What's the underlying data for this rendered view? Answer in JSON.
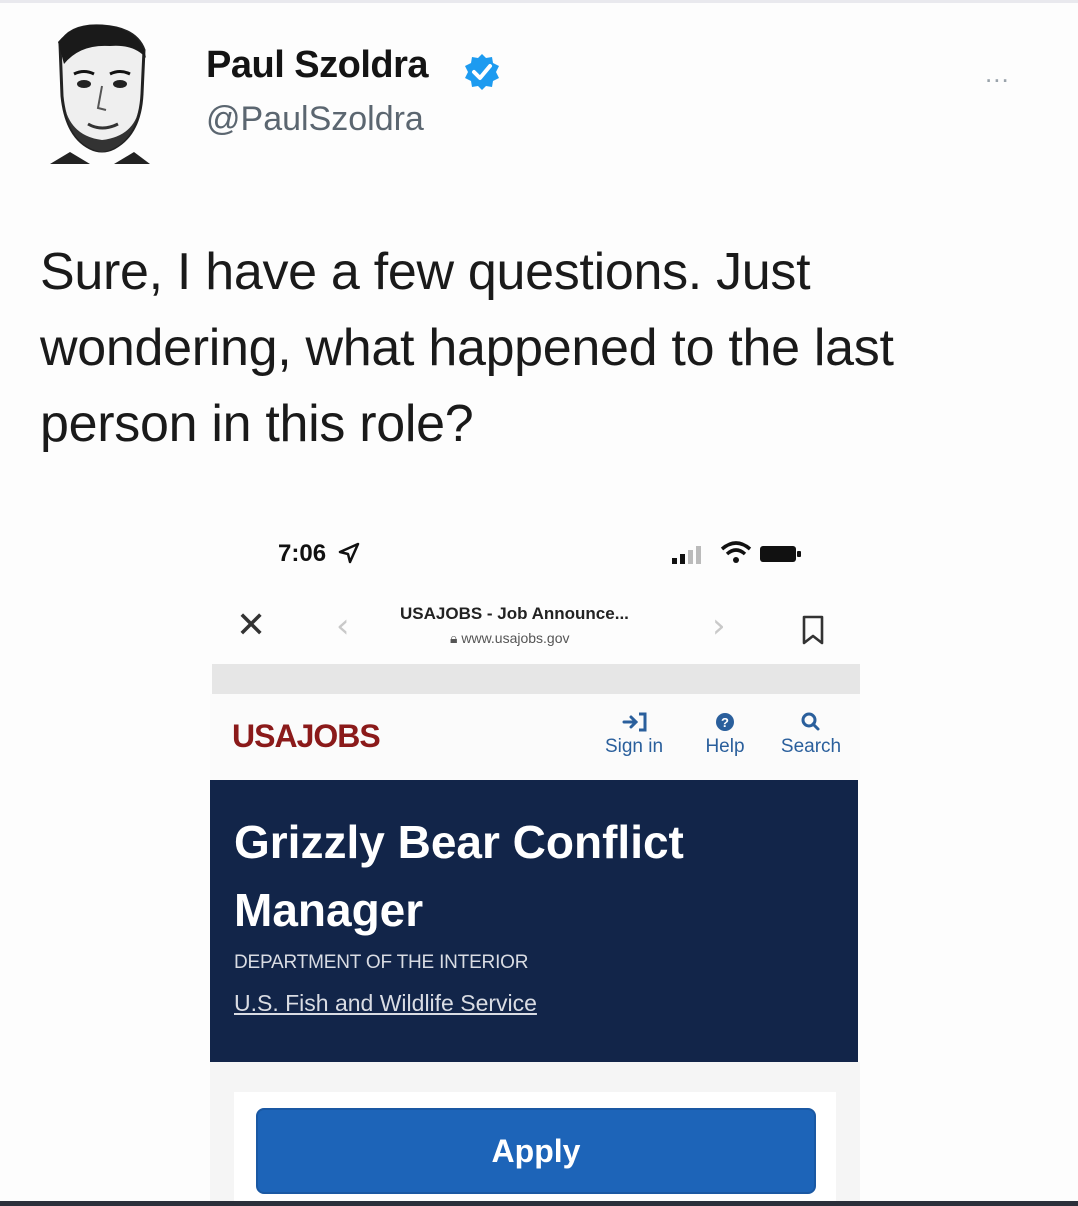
{
  "tweet": {
    "author_name": "Paul Szoldra",
    "handle": "@PaulSzoldra",
    "more_label": "...",
    "text": "Sure, I have a few questions. Just wondering, what happened to the last person in this role?"
  },
  "screenshot": {
    "status_bar": {
      "time": "7:06"
    },
    "browser": {
      "page_title": "USAJOBS - Job Announce...",
      "url": "www.usajobs.gov"
    },
    "site": {
      "logo": "USAJOBS",
      "nav": [
        {
          "label": "Sign in",
          "icon": "sign-in-icon"
        },
        {
          "label": "Help",
          "icon": "help-icon"
        },
        {
          "label": "Search",
          "icon": "search-icon"
        }
      ]
    },
    "job": {
      "title_line1": "Grizzly Bear Conflict",
      "title_line2": "Manager",
      "department": "DEPARTMENT OF THE INTERIOR",
      "agency": "U.S. Fish and Wildlife Service",
      "apply_label": "Apply"
    }
  },
  "colors": {
    "verified_badge": "#1d9bf0",
    "banner_bg": "#122549",
    "apply_bg": "#1d64b8",
    "logo": "#8b1a1a"
  }
}
